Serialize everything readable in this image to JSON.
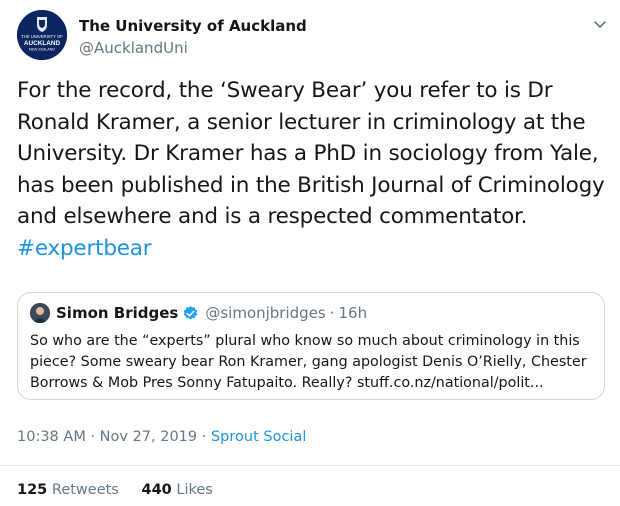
{
  "author": {
    "name": "The University of Auckland",
    "handle": "@AucklandUni",
    "logo_lines": [
      "THE UNIVERSITY OF",
      "AUCKLAND",
      "NEW ZEALAND"
    ]
  },
  "tweet": {
    "lines": [
      "For the record, the ‘Sweary Bear’ you refer to is Dr",
      "Ronald Kramer, a senior lecturer in criminology at the",
      "University. Dr Kramer has a PhD in sociology from Yale,",
      "has been published in the British Journal of Criminology",
      "and elsewhere and is a respected commentator."
    ],
    "hashtag": "#expertbear"
  },
  "quote": {
    "name": "Simon Bridges",
    "handle": "@simonjbridges",
    "dot": "·",
    "time": "16h",
    "lines": [
      "So who are the “experts” plural who know so much about criminology in this",
      "piece? Some sweary bear Ron Kramer, gang apologist Denis O’Rielly, Chester",
      "Borrows & Mob Pres Sonny Fatupaito. Really? stuff.co.nz/national/polit..."
    ]
  },
  "meta": {
    "time": "10:38 AM",
    "sep1": "·",
    "date": "Nov 27, 2019",
    "sep2": "·",
    "source": "Sprout Social"
  },
  "stats": {
    "retweets_count": "125",
    "retweets_label": "Retweets",
    "likes_count": "440",
    "likes_label": "Likes"
  },
  "colors": {
    "link": "#1b95e0",
    "secondary_text": "#657786",
    "primary_text": "#14171a",
    "logo_bg": "#0b2560",
    "border": "#ccd6dd"
  }
}
